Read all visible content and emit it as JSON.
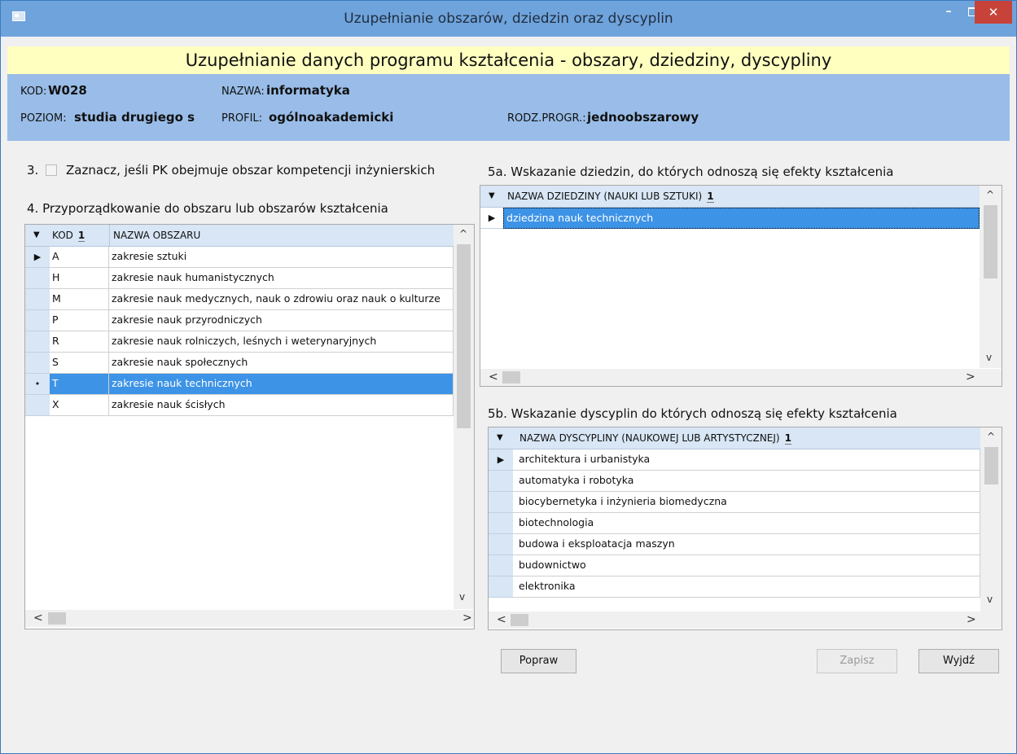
{
  "window": {
    "title": "Uzupełnianie obszarów, dziedzin oraz dyscyplin",
    "min": "–",
    "close": "✕"
  },
  "banner": "Uzupełnianie danych programu kształcenia - obszary, dziedziny, dyscypliny",
  "info": {
    "kod_label": "KOD:",
    "kod": "W028",
    "nazwa_label": "NAZWA:",
    "nazwa": "informatyka",
    "poziom_label": "POZIOM:",
    "poziom": "studia drugiego s",
    "profil_label": "PROFIL:",
    "profil": "ogólnoakademicki",
    "rodz_label": "RODZ.PROGR.:",
    "rodz": "jednoobszarowy"
  },
  "section3": "3.",
  "section3_text": "Zaznacz, jeśli PK obejmuje obszar kompetencji inżynierskich",
  "section4": "4. Przyporządkowanie do obszaru lub obszarów  kształcenia",
  "grid_obszary": {
    "col_kod": "KOD",
    "col_nazwa": "NAZWA OBSZARU",
    "sort": "1",
    "rows": [
      {
        "kod": "A",
        "nazwa": "zakresie sztuki"
      },
      {
        "kod": "H",
        "nazwa": "zakresie nauk humanistycznych"
      },
      {
        "kod": "M",
        "nazwa": "zakresie nauk medycznych, nauk o zdrowiu oraz nauk o kulturze"
      },
      {
        "kod": "P",
        "nazwa": "zakresie nauk przyrodniczych"
      },
      {
        "kod": "R",
        "nazwa": "zakresie nauk rolniczych, leśnych i weterynaryjnych"
      },
      {
        "kod": "S",
        "nazwa": "zakresie nauk społecznych"
      },
      {
        "kod": "T",
        "nazwa": "zakresie nauk technicznych"
      },
      {
        "kod": "X",
        "nazwa": "zakresie nauk ścisłych"
      }
    ]
  },
  "section5a": "5a. Wskazanie dziedzin, do których odnoszą się efekty kształcenia",
  "grid_dziedziny": {
    "col": "NAZWA DZIEDZINY (NAUKI LUB SZTUKI)",
    "sort": "1",
    "rows": [
      {
        "nazwa": "dziedzina nauk technicznych"
      }
    ]
  },
  "section5b": "5b. Wskazanie dyscyplin do których odnoszą się efekty kształcenia",
  "grid_dyscypliny": {
    "col": "NAZWA DYSCYPLINY (NAUKOWEJ LUB ARTYSTYCZNEJ)",
    "sort": "1",
    "rows": [
      {
        "nazwa": "architektura i urbanistyka"
      },
      {
        "nazwa": "automatyka i robotyka"
      },
      {
        "nazwa": "biocybernetyka i inżynieria biomedyczna"
      },
      {
        "nazwa": "biotechnologia"
      },
      {
        "nazwa": "budowa i eksploatacja maszyn"
      },
      {
        "nazwa": "budownictwo"
      },
      {
        "nazwa": "elektronika"
      }
    ]
  },
  "buttons": {
    "popraw": "Popraw",
    "zapisz": "Zapisz",
    "wyjdz": "Wyjdź"
  },
  "glyphs": {
    "sort_down": "▼",
    "row_current": "▶",
    "row_dot": "•",
    "left": "<",
    "right": ">",
    "up": "^",
    "down": "v"
  }
}
